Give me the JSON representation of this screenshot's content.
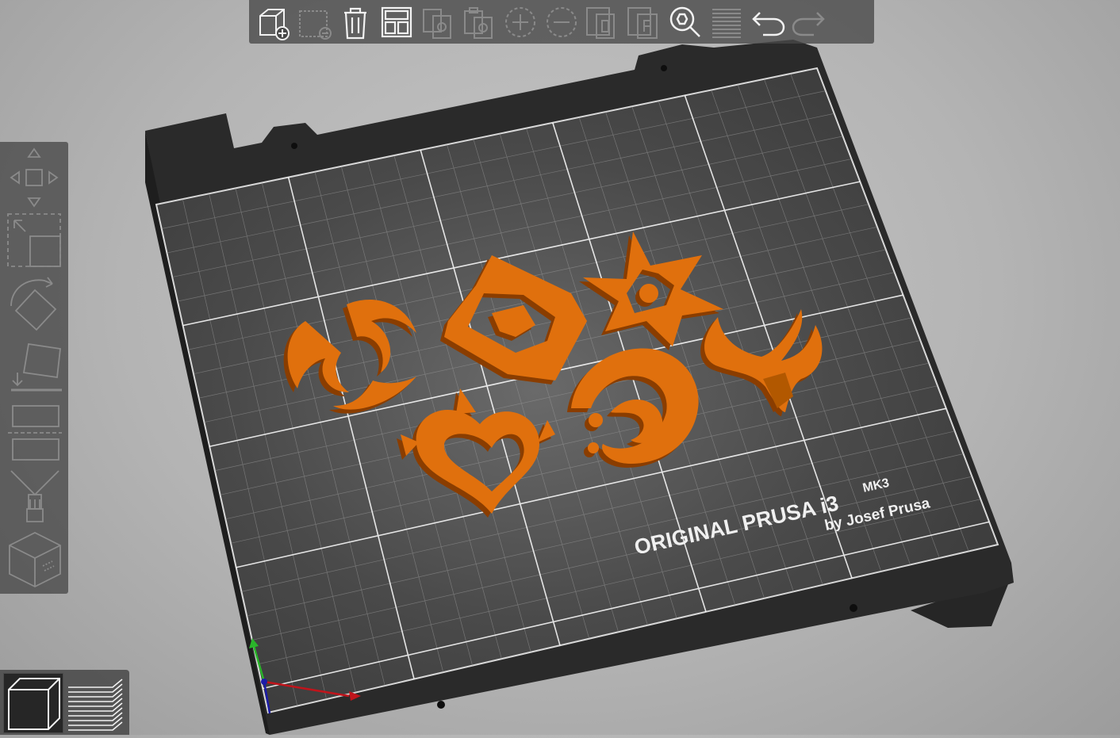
{
  "bed": {
    "brand_line": "ORIGINAL PRUSA i3",
    "model_suffix": "MK3",
    "byline": "by Josef Prusa",
    "surface_color": "#3c3c3c",
    "frame_color": "#2a2a2a",
    "grid_color": "#ffffff"
  },
  "objects": {
    "color": "#e0700f",
    "items": [
      "anemo-emblem",
      "geo-emblem",
      "electro-emblem",
      "dendro-emblem",
      "hydro-emblem",
      "pyro-emblem"
    ]
  },
  "axes": {
    "x_color": "#c0141b",
    "y_color": "#2ab52a",
    "z_color": "#1c1ca8"
  },
  "top_toolbar": {
    "buttons": [
      "add-icon",
      "delete-icon",
      "delete-all-icon",
      "arrange-icon",
      "copy-icon",
      "paste-icon",
      "add-instance-icon",
      "remove-instance-icon",
      "split-objects-icon",
      "split-parts-icon",
      "search-icon",
      "layers-editing-icon",
      "undo-icon",
      "redo-icon"
    ]
  },
  "left_toolbar": {
    "tools": [
      "move-icon",
      "scale-icon",
      "rotate-icon",
      "place-on-face-icon",
      "cut-icon",
      "paint-supports-icon",
      "seam-painting-icon"
    ]
  },
  "view_switch": {
    "views": [
      "3d-view-icon",
      "preview-layers-icon"
    ],
    "active": "3d-view-icon"
  }
}
